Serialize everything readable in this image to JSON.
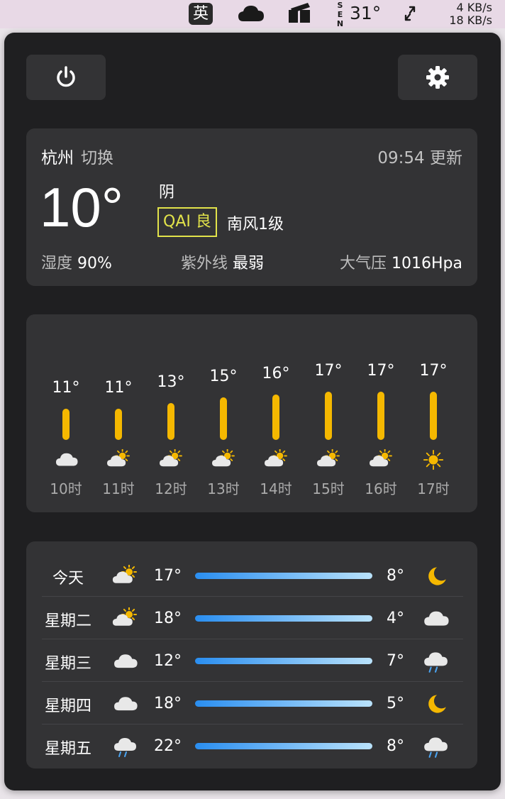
{
  "menubar": {
    "input_method": "英",
    "sensor_label": "SEN",
    "temperature": "31°",
    "net_up": "4 KB/s",
    "net_down": "18 KB/s"
  },
  "current": {
    "city": "杭州",
    "switch_label": "切换",
    "update_time": "09:54 更新",
    "temp": "10°",
    "condition": "阴",
    "aqi": "QAI 良",
    "wind": "南风1级",
    "humidity_label": "湿度",
    "humidity_value": "90%",
    "uv_label": "紫外线",
    "uv_value": "最弱",
    "pressure_label": "大气压",
    "pressure_value": "1016Hpa"
  },
  "hourly": [
    {
      "hour": "10时",
      "temp": "11°",
      "value": 11,
      "icon": "cloud-icon"
    },
    {
      "hour": "11时",
      "temp": "11°",
      "value": 11,
      "icon": "partly-cloudy-icon"
    },
    {
      "hour": "12时",
      "temp": "13°",
      "value": 13,
      "icon": "partly-cloudy-icon"
    },
    {
      "hour": "13时",
      "temp": "15°",
      "value": 15,
      "icon": "partly-cloudy-icon"
    },
    {
      "hour": "14时",
      "temp": "16°",
      "value": 16,
      "icon": "partly-cloudy-icon"
    },
    {
      "hour": "15时",
      "temp": "17°",
      "value": 17,
      "icon": "partly-cloudy-icon"
    },
    {
      "hour": "16时",
      "temp": "17°",
      "value": 17,
      "icon": "partly-cloudy-icon"
    },
    {
      "hour": "17时",
      "temp": "17°",
      "value": 17,
      "icon": "sun-icon"
    }
  ],
  "daily": [
    {
      "day": "今天",
      "icon": "partly-cloudy-icon",
      "high": "17°",
      "low": "8°",
      "night_icon": "moon-icon"
    },
    {
      "day": "星期二",
      "icon": "partly-cloudy-icon",
      "high": "18°",
      "low": "4°",
      "night_icon": "cloud-icon"
    },
    {
      "day": "星期三",
      "icon": "cloud-icon",
      "high": "12°",
      "low": "7°",
      "night_icon": "rain-cloud-icon"
    },
    {
      "day": "星期四",
      "icon": "cloud-icon",
      "high": "18°",
      "low": "5°",
      "night_icon": "moon-icon"
    },
    {
      "day": "星期五",
      "icon": "rain-cloud-icon",
      "high": "22°",
      "low": "8°",
      "night_icon": "rain-cloud-icon"
    }
  ],
  "colors": {
    "accent_yellow": "#f5b800",
    "aqi_yellow": "#e2e34a",
    "bar_start": "#2a8ef0",
    "bar_end": "#b9e2fb"
  }
}
